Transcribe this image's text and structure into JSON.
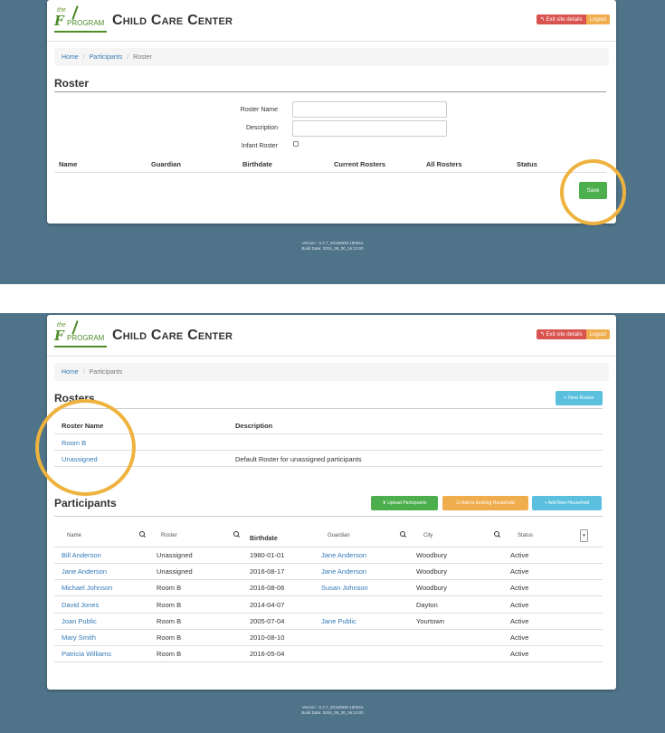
{
  "app": {
    "title": "Child Care Center",
    "logo": {
      "the": "the",
      "f": "F",
      "program": "PROGRAM"
    },
    "exit_label": "↰ Exit site details",
    "logout_label": "Logout"
  },
  "footer": {
    "version": "Version : 0.3.7_20160830.180644",
    "build": "Build Date: 2016_08_30_16:13:00"
  },
  "screen1": {
    "breadcrumb": [
      "Home",
      "Participants",
      "Roster"
    ],
    "title": "Roster",
    "form": {
      "name_label": "Roster Name",
      "name_value": "",
      "description_label": "Description",
      "description_value": "",
      "infant_label": "Infant Roster"
    },
    "columns": [
      "Name",
      "Guardian",
      "Birthdate",
      "Current Rosters",
      "All Rosters",
      "Status"
    ],
    "save_label": "Save"
  },
  "screen2": {
    "breadcrumb": [
      "Home",
      "Participants"
    ],
    "rosters_title": "Rosters",
    "new_roster_label": "+ New Roster",
    "roster_columns": [
      "Roster Name",
      "Description"
    ],
    "rosters": [
      {
        "name": "Room B",
        "description": ""
      },
      {
        "name": "Unassigned",
        "description": "Default Roster for unassigned participants"
      }
    ],
    "participants_title": "Participants",
    "actions": {
      "upload": "⬆ Upload Participants",
      "existing": "☑ Add to Existing Household",
      "new_household": "+ Add New Household"
    },
    "participant_columns": {
      "name": "Name",
      "roster": "Roster",
      "birthdate": "Birthdate",
      "guardian": "Guardian",
      "city": "City",
      "status": "Status"
    },
    "participants": [
      {
        "name": "Bill Anderson",
        "roster": "Unassigned",
        "birthdate": "1980-01-01",
        "guardian": "Jane Anderson",
        "city": "Woodbury",
        "status": "Active"
      },
      {
        "name": "Jane Anderson",
        "roster": "Unassigned",
        "birthdate": "2016-08-17",
        "guardian": "Jane Anderson",
        "city": "Woodbury",
        "status": "Active"
      },
      {
        "name": "Michael Johnson",
        "roster": "Room B",
        "birthdate": "2016-08-06",
        "guardian": "Susan Johnson",
        "city": "Woodbury",
        "status": "Active"
      },
      {
        "name": "David Jones",
        "roster": "Room B",
        "birthdate": "2014-04-07",
        "guardian": "",
        "city": "Dayton",
        "status": "Active"
      },
      {
        "name": "Joan Public",
        "roster": "Room B",
        "birthdate": "2005-07-04",
        "guardian": "Jane Public",
        "city": "Yourtown",
        "status": "Active"
      },
      {
        "name": "Mary Smith",
        "roster": "Room B",
        "birthdate": "2010-08-10",
        "guardian": "",
        "city": "",
        "status": "Active"
      },
      {
        "name": "Patricia Williams",
        "roster": "Room B",
        "birthdate": "2016-05-04",
        "guardian": "",
        "city": "",
        "status": "Active"
      }
    ]
  },
  "colors": {
    "background_band": "#4f7389",
    "highlight_ring": "#eeb33f",
    "save": "#4cae4c",
    "exit": "#d9534f",
    "logout": "#f0ad4e",
    "link": "#337ab7"
  }
}
